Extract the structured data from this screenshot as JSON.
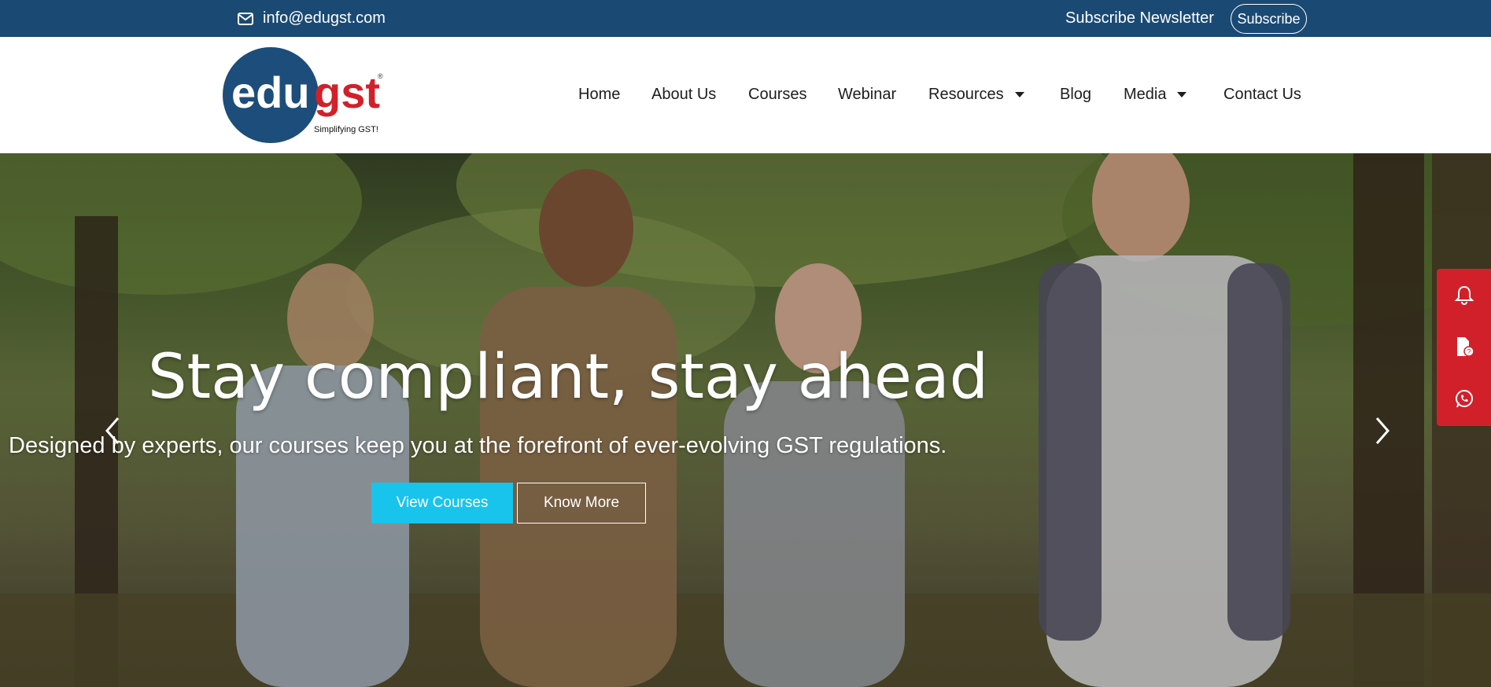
{
  "topbar": {
    "email": "info@edugst.com",
    "email_icon": "envelope-icon",
    "subscribe_text": "Subscribe Newsletter",
    "subscribe_button": "Subscribe"
  },
  "logo": {
    "word_left": "edu",
    "word_right": "gst",
    "tagline": "Simplifying GST!",
    "registered": "®"
  },
  "nav": {
    "items": [
      {
        "label": "Home"
      },
      {
        "label": "About Us"
      },
      {
        "label": "Courses"
      },
      {
        "label": "Webinar"
      },
      {
        "label": "Resources"
      },
      {
        "label": "Blog"
      },
      {
        "label": "Media"
      },
      {
        "label": "Contact Us"
      }
    ]
  },
  "hero": {
    "title": "Stay compliant, stay ahead",
    "subtitle": "Designed by experts, our courses keep you at the forefront of ever-evolving GST regulations.",
    "primary_button": "View Courses",
    "secondary_button": "Know More"
  },
  "side_actions": {
    "icons": [
      "bell-icon",
      "document-question-icon",
      "whatsapp-icon"
    ]
  },
  "colors": {
    "topbar_bg": "#1a4a73",
    "primary_button": "#18c4ec",
    "side_bar": "#d2202a",
    "logo_circle": "#1d4d7a",
    "logo_red": "#d2202a"
  }
}
